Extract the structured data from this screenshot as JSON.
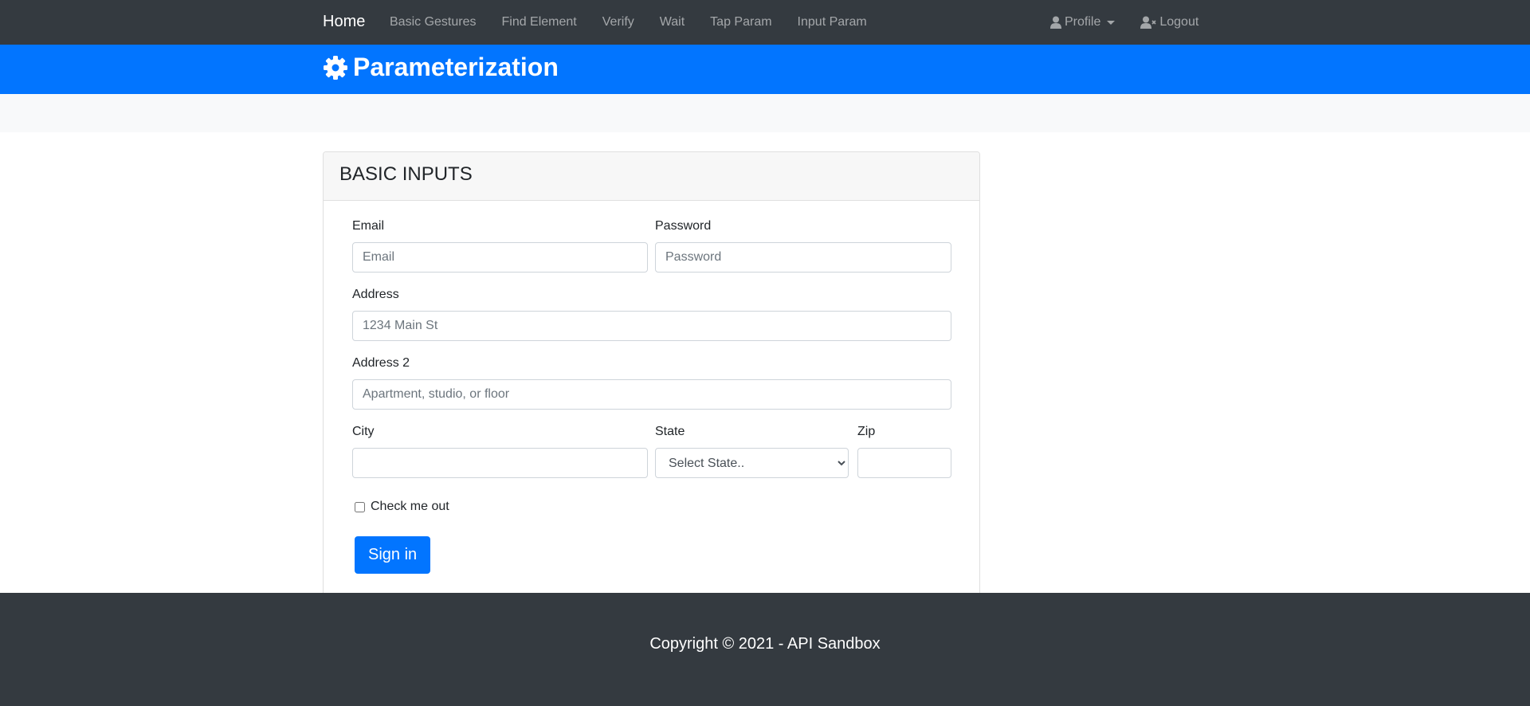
{
  "nav": {
    "brand": "Home",
    "items": [
      "Basic Gestures",
      "Find Element",
      "Verify",
      "Wait",
      "Tap Param",
      "Input Param"
    ],
    "profile": "Profile",
    "logout": "Logout",
    "icons": {
      "profile": "user-icon",
      "logout": "user-times-icon"
    }
  },
  "banner": {
    "title": "Parameterization",
    "icon": "gear-icon",
    "color": "#0275ff"
  },
  "card": {
    "title": "BASIC INPUTS"
  },
  "form": {
    "email": {
      "label": "Email",
      "placeholder": "Email",
      "value": ""
    },
    "password": {
      "label": "Password",
      "placeholder": "Password",
      "value": ""
    },
    "address": {
      "label": "Address",
      "placeholder": "1234 Main St",
      "value": ""
    },
    "address2": {
      "label": "Address 2",
      "placeholder": "Apartment, studio, or floor",
      "value": ""
    },
    "city": {
      "label": "City",
      "value": ""
    },
    "state": {
      "label": "State",
      "selected": "Select State.."
    },
    "zip": {
      "label": "Zip",
      "value": ""
    },
    "check": {
      "label": "Check me out",
      "checked": false
    },
    "submit": "Sign in"
  },
  "footer": {
    "text": "Copyright © 2021 - API Sandbox"
  }
}
